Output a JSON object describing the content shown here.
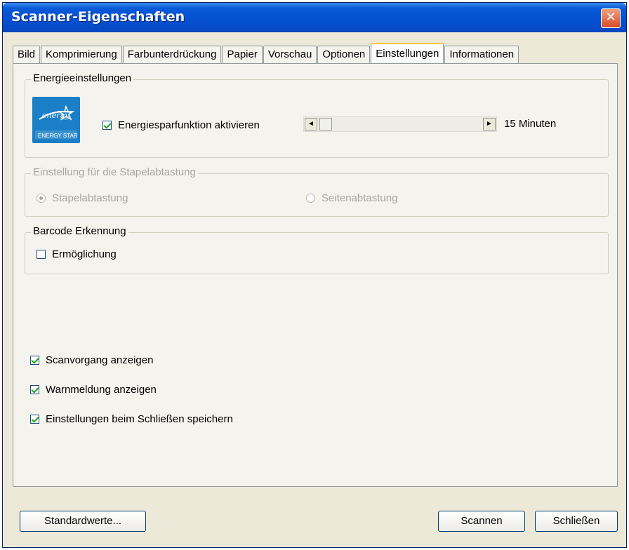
{
  "window": {
    "title": "Scanner-Eigenschaften",
    "close_label": "✕"
  },
  "tabs": [
    {
      "label": "Bild"
    },
    {
      "label": "Komprimierung"
    },
    {
      "label": "Farbunterdrückung"
    },
    {
      "label": "Papier"
    },
    {
      "label": "Vorschau"
    },
    {
      "label": "Optionen"
    },
    {
      "label": "Einstellungen",
      "active": true
    },
    {
      "label": "Informationen"
    }
  ],
  "energy": {
    "group_label": "Energieeinstellungen",
    "logo_text": "ENERGY STAR",
    "checkbox_label": "Energiesparfunktion aktivieren",
    "checked": true,
    "slider_value": "15 Minuten"
  },
  "batch": {
    "group_label": "Einstellung für die Stapelabtastung",
    "option1": "Stapelabtastung",
    "option2": "Seitenabtastung",
    "selected": "Stapelabtastung"
  },
  "barcode": {
    "group_label": "Barcode Erkennung",
    "checkbox_label": "Ermöglichung",
    "checked": false
  },
  "options": [
    {
      "label": "Scanvorgang anzeigen",
      "checked": true
    },
    {
      "label": "Warnmeldung anzeigen",
      "checked": true
    },
    {
      "label": "Einstellungen beim Schließen speichern",
      "checked": true
    }
  ],
  "buttons": {
    "defaults": "Standardwerte...",
    "scan": "Scannen",
    "close": "Schließen"
  }
}
